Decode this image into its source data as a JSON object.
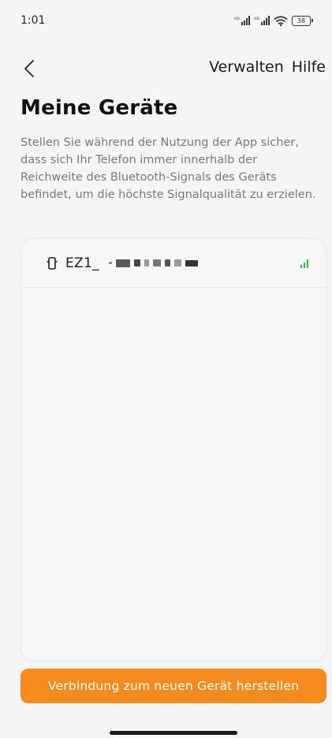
{
  "status_bar": {
    "time": "1:01",
    "battery": "38"
  },
  "nav": {
    "manage_label": "Verwalten",
    "help_label": "Hilfe"
  },
  "page": {
    "title": "Meine Geräte",
    "description": "Stellen Sie während der Nutzung der App sicher, dass sich Ihr Telefon immer innerhalb der Reichweite des Bluetooth-Signals des Geräts befindet, um die höchste Signalqualität zu erzielen."
  },
  "devices": [
    {
      "name": "EZ1_",
      "signal_color": "#3bb54a"
    }
  ],
  "actions": {
    "connect_label": "Verbindung zum neuen Gerät herstellen"
  },
  "colors": {
    "accent": "#f58a1f",
    "background": "#f5f5f5",
    "signal": "#3bb54a"
  }
}
